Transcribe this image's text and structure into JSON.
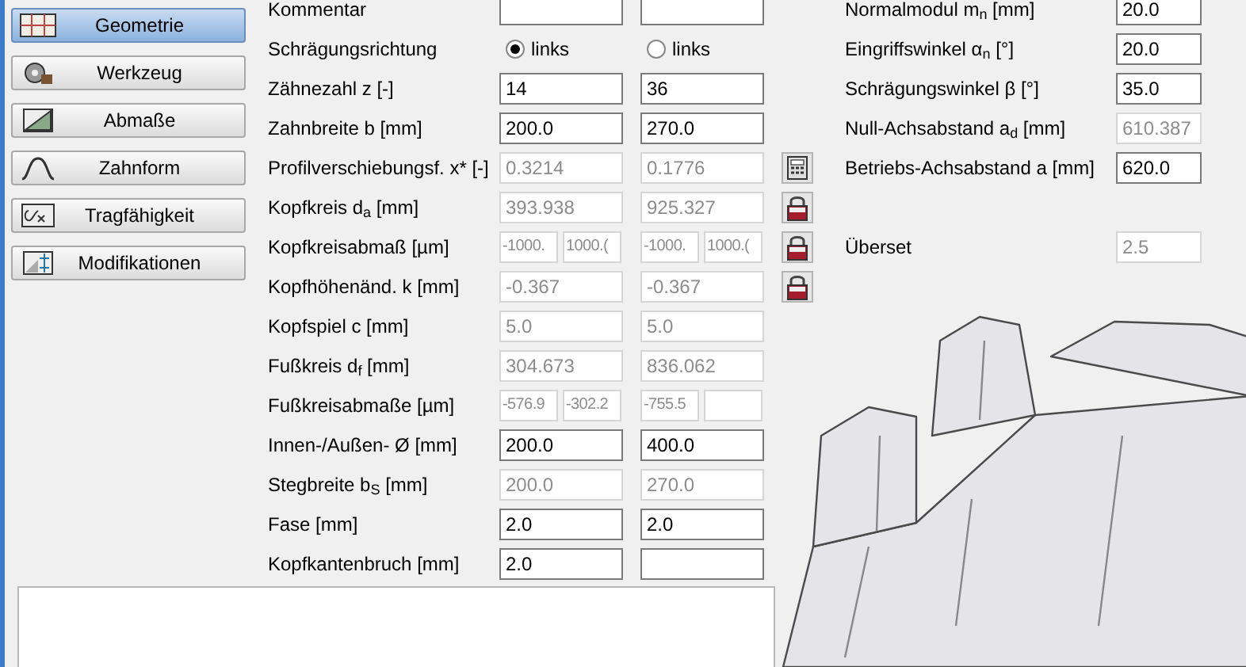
{
  "sidebar": {
    "items": [
      {
        "label": "Geometrie",
        "selected": true
      },
      {
        "label": "Werkzeug",
        "selected": false
      },
      {
        "label": "Abmaße",
        "selected": false
      },
      {
        "label": "Zahnform",
        "selected": false
      },
      {
        "label": "Tragfähigkeit",
        "selected": false
      },
      {
        "label": "Modifikationen",
        "selected": false
      }
    ]
  },
  "form": {
    "rows": [
      {
        "kind": "fields",
        "label": "Kommentar",
        "cols": [
          [
            {
              "enabled": true
            }
          ],
          [
            {
              "enabled": true
            }
          ]
        ]
      },
      {
        "kind": "radio",
        "label": "Schrägungsrichtung",
        "options": [
          {
            "label": "links",
            "selected": true
          },
          {
            "label": "links",
            "selected": false
          }
        ]
      },
      {
        "kind": "fields",
        "label": "Zähnezahl z [-]",
        "cols": [
          [
            {
              "value": "14",
              "enabled": true
            }
          ],
          [
            {
              "value": "36",
              "enabled": true
            }
          ]
        ]
      },
      {
        "kind": "fields",
        "label": "Zahnbreite b [mm]",
        "cols": [
          [
            {
              "value": "200.0",
              "enabled": true
            }
          ],
          [
            {
              "value": "270.0",
              "enabled": true
            }
          ]
        ]
      },
      {
        "kind": "fields",
        "label": "Profilverschiebungsf. x* [-]",
        "cols": [
          [
            {
              "value": "0.3214",
              "enabled": false
            }
          ],
          [
            {
              "value": "0.1776",
              "enabled": false
            }
          ]
        ],
        "action": {
          "kind": "calculator"
        }
      },
      {
        "kind": "fields",
        "label": "Kopfkreis d$_{a}$ [mm]",
        "cols": [
          [
            {
              "value": "393.938",
              "enabled": false
            }
          ],
          [
            {
              "value": "925.327",
              "enabled": false
            }
          ]
        ],
        "action": {
          "kind": "lock"
        }
      },
      {
        "kind": "fields",
        "label": "Kopfkreisabmaß [µm]",
        "cols": [
          [
            {
              "value": "-1000.",
              "enabled": false
            },
            {
              "value": "1000.(",
              "enabled": false
            }
          ],
          [
            {
              "value": "-1000.",
              "enabled": false
            },
            {
              "value": "1000.(",
              "enabled": false
            }
          ]
        ],
        "action": {
          "kind": "lock"
        }
      },
      {
        "kind": "fields",
        "label": "Kopfhöhenänd. k [mm]",
        "cols": [
          [
            {
              "value": "-0.367",
              "enabled": false
            }
          ],
          [
            {
              "value": "-0.367",
              "enabled": false
            }
          ]
        ],
        "action": {
          "kind": "lock"
        }
      },
      {
        "kind": "fields",
        "label": "Kopfspiel c [mm]",
        "cols": [
          [
            {
              "value": "5.0",
              "enabled": false
            }
          ],
          [
            {
              "value": "5.0",
              "enabled": false
            }
          ]
        ]
      },
      {
        "kind": "fields",
        "label": "Fußkreis d$_{f}$ [mm]",
        "cols": [
          [
            {
              "value": "304.673",
              "enabled": false
            }
          ],
          [
            {
              "value": "836.062",
              "enabled": false
            }
          ]
        ]
      },
      {
        "kind": "fields",
        "label": "Fußkreisabmaße [µm]",
        "cols": [
          [
            {
              "value": "-576.9",
              "enabled": false
            },
            {
              "value": "-302.2",
              "enabled": false
            }
          ],
          [
            {
              "value": "-755.5",
              "enabled": false
            },
            {
              "enabled": false
            }
          ]
        ]
      },
      {
        "kind": "fields",
        "label": "Innen-/Außen- Ø [mm]",
        "cols": [
          [
            {
              "value": "200.0",
              "enabled": true
            }
          ],
          [
            {
              "value": "400.0",
              "enabled": true
            }
          ]
        ]
      },
      {
        "kind": "fields",
        "label": "Stegbreite b$_{S}$ [mm]",
        "cols": [
          [
            {
              "value": "200.0",
              "enabled": false
            }
          ],
          [
            {
              "value": "270.0",
              "enabled": false
            }
          ]
        ]
      },
      {
        "kind": "fields",
        "label": "Fase [mm]",
        "cols": [
          [
            {
              "value": "2.0",
              "enabled": true
            }
          ],
          [
            {
              "value": "2.0",
              "enabled": true
            }
          ]
        ]
      },
      {
        "kind": "fields",
        "label": "Kopfkantenbruch [mm]",
        "cols": [
          [
            {
              "value": "2.0",
              "enabled": true
            }
          ],
          [
            {
              "enabled": true
            }
          ]
        ]
      }
    ]
  },
  "params": [
    {
      "label": "Normalmodul m$_{n}$ [mm]",
      "value": "20.0",
      "enabled": true
    },
    {
      "label": "Eingriffswinkel α$_{n}$ [°]",
      "value": "20.0",
      "enabled": true
    },
    {
      "label": "Schrägungswinkel β [°]",
      "value": "35.0",
      "enabled": true
    },
    {
      "label": "Null-Achsabstand a$_{d}$ [mm]",
      "value": "610.387",
      "enabled": false
    },
    {
      "label": "Betriebs-Achsabstand a [mm]",
      "value": "620.0",
      "enabled": true
    },
    {
      "label": "Überset",
      "value": "2.5",
      "enabled": false
    }
  ]
}
